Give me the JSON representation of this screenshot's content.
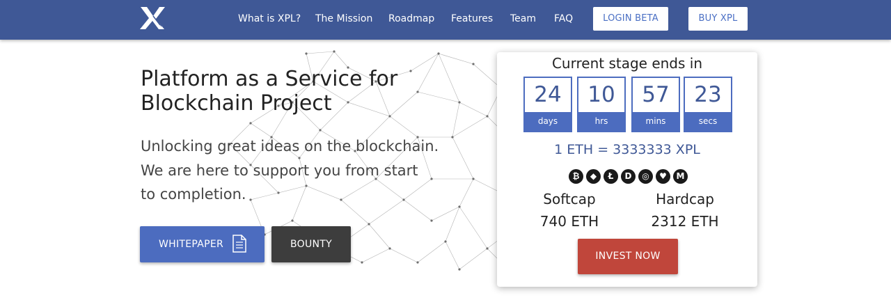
{
  "nav": {
    "links": [
      "What is XPL?",
      "The Mission",
      "Roadmap",
      "Features",
      "Team",
      "FAQ"
    ],
    "login_label": "LOGIN BETA",
    "buy_label": "BUY XPL"
  },
  "hero": {
    "title_line1": "Platform as a Service for",
    "title_line2": "Blockchain Project",
    "subtitle_line1": "Unlocking great ideas on the blockchain.",
    "subtitle_line2": "We are here to support you from start",
    "subtitle_line3": "to completion.",
    "whitepaper_label": "WHITEPAPER",
    "bounty_label": "BOUNTY"
  },
  "stage": {
    "title": "Current stage ends in",
    "countdown": [
      {
        "value": "24",
        "unit": "days"
      },
      {
        "value": "10",
        "unit": "hrs"
      },
      {
        "value": "57",
        "unit": "mins"
      },
      {
        "value": "23",
        "unit": "secs"
      }
    ],
    "rate": "1 ETH = 3333333 XPL",
    "coins": [
      "bitcoin-icon",
      "ethereum-icon",
      "litecoin-icon",
      "dash-icon",
      "zcash-icon",
      "ripple-icon",
      "monero-icon"
    ],
    "softcap_label": "Softcap",
    "softcap_value": "740 ETH",
    "hardcap_label": "Hardcap",
    "hardcap_value": "2312 ETH",
    "invest_label": "INVEST NOW"
  },
  "colors": {
    "brand": "#3f5896",
    "accent": "#4c6cbf",
    "invest": "#c0463b",
    "dark_button": "#3d3d3d"
  }
}
